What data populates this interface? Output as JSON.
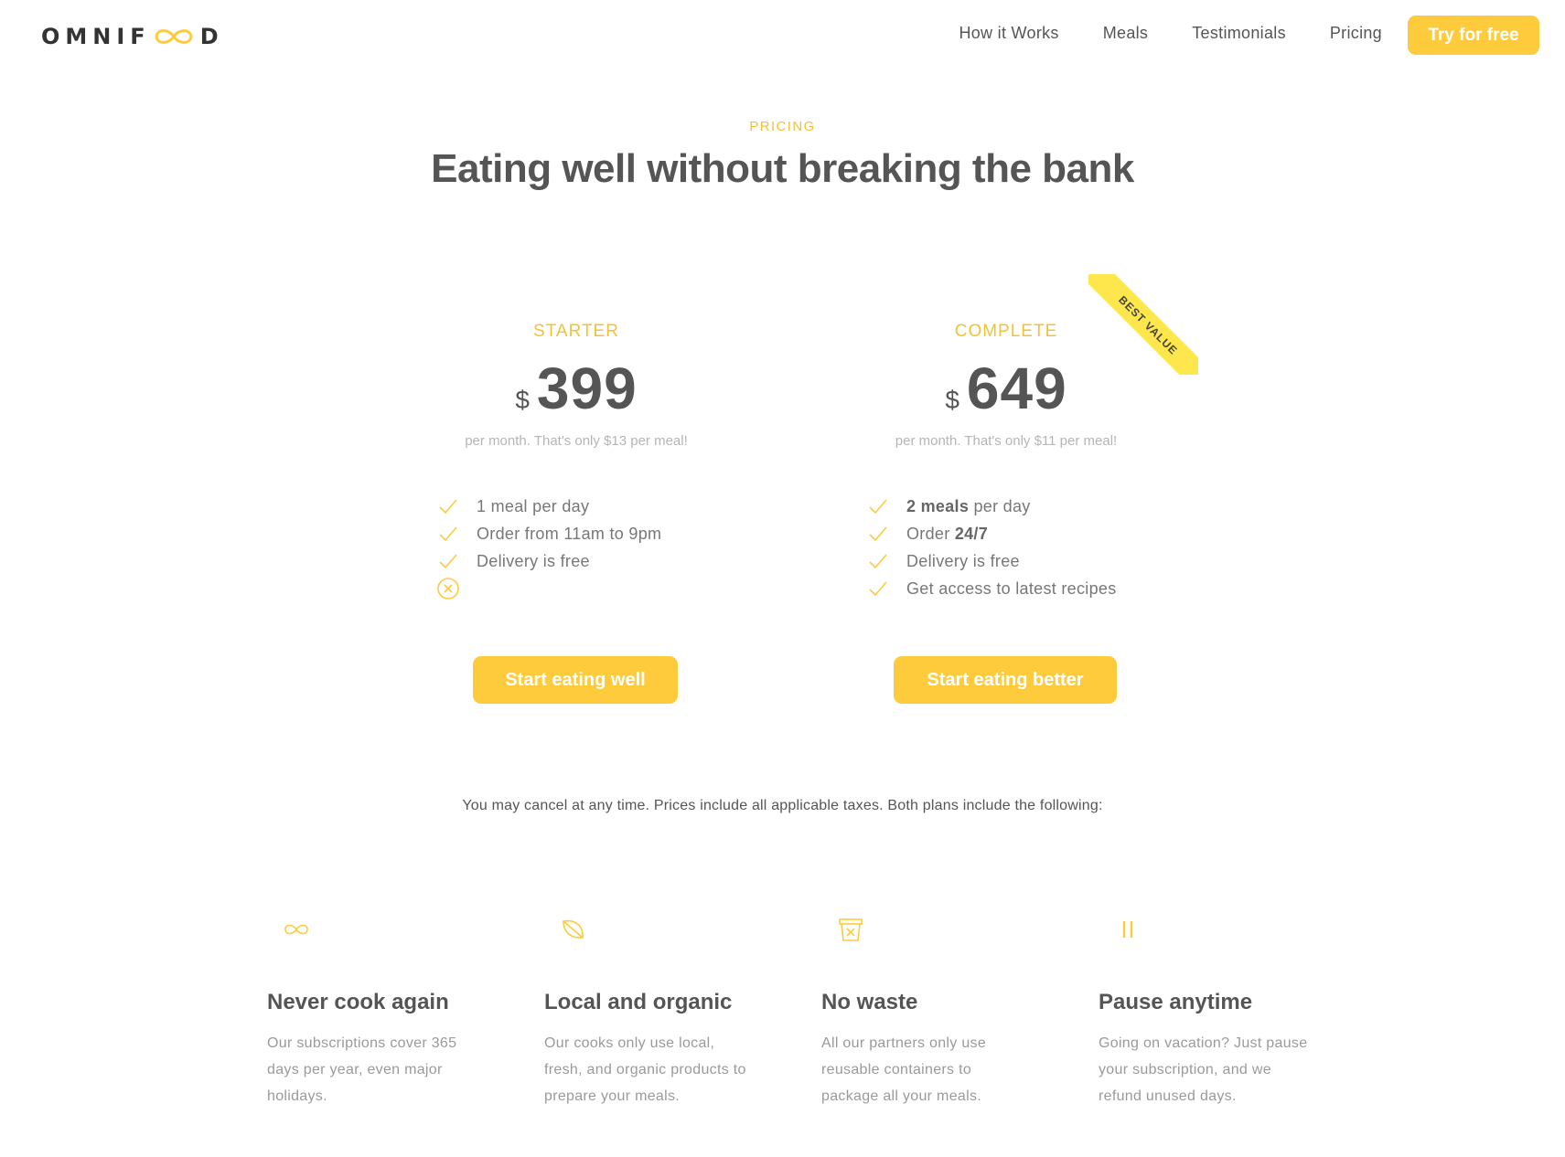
{
  "brand": {
    "logo_text_left": "OMNIF",
    "logo_text_right": "D",
    "accent": "#fdcb3b",
    "logo_icon": "infinity-loop-icon"
  },
  "nav": {
    "items": [
      {
        "label": "How it Works"
      },
      {
        "label": "Meals"
      },
      {
        "label": "Testimonials"
      },
      {
        "label": "Pricing"
      }
    ],
    "cta": "Try for free"
  },
  "section": {
    "subheading": "PRICING",
    "heading": "Eating well without breaking the bank"
  },
  "plans": [
    {
      "name": "STARTER",
      "currency": "$",
      "price": "399",
      "per": "per month. That's only $13 per meal!",
      "features": [
        {
          "icon": "checkmark-icon",
          "text": "1 meal per day"
        },
        {
          "icon": "checkmark-icon",
          "text": "Order from 11am to 9pm"
        },
        {
          "icon": "checkmark-icon",
          "text": "Delivery is free"
        },
        {
          "icon": "close-circle-icon",
          "text": ""
        }
      ],
      "button": "Start eating well"
    },
    {
      "name": "COMPLETE",
      "currency": "$",
      "price": "649",
      "per": "per month. That's only $11 per meal!",
      "ribbon": "BEST VALUE",
      "features": [
        {
          "icon": "checkmark-icon",
          "bold": "2 meals",
          "text": " per day"
        },
        {
          "icon": "checkmark-icon",
          "pre": "Order ",
          "bold": "24/7"
        },
        {
          "icon": "checkmark-icon",
          "text": "Delivery is free"
        },
        {
          "icon": "checkmark-icon",
          "text": "Get access to latest recipes"
        }
      ],
      "button": "Start eating better"
    }
  ],
  "cancel_note": "You may cancel at any time. Prices include all applicable taxes. Both plans include the following:",
  "features": [
    {
      "icon": "infinity-icon",
      "title": "Never cook again",
      "lines": [
        "Our subscriptions cover 365",
        "days per year, even major",
        "holidays."
      ]
    },
    {
      "icon": "leaf-icon",
      "title": "Local and organic",
      "lines": [
        "Our cooks only use local,",
        "fresh, and organic products to",
        "prepare your meals."
      ]
    },
    {
      "icon": "trash-icon",
      "title": "No waste",
      "lines": [
        "All our partners only use",
        "reusable containers to",
        "package all your meals."
      ]
    },
    {
      "icon": "pause-icon",
      "title": "Pause anytime",
      "lines": [
        "Going on vacation? Just pause",
        "your subscription, and we",
        "refund unused days."
      ]
    }
  ]
}
